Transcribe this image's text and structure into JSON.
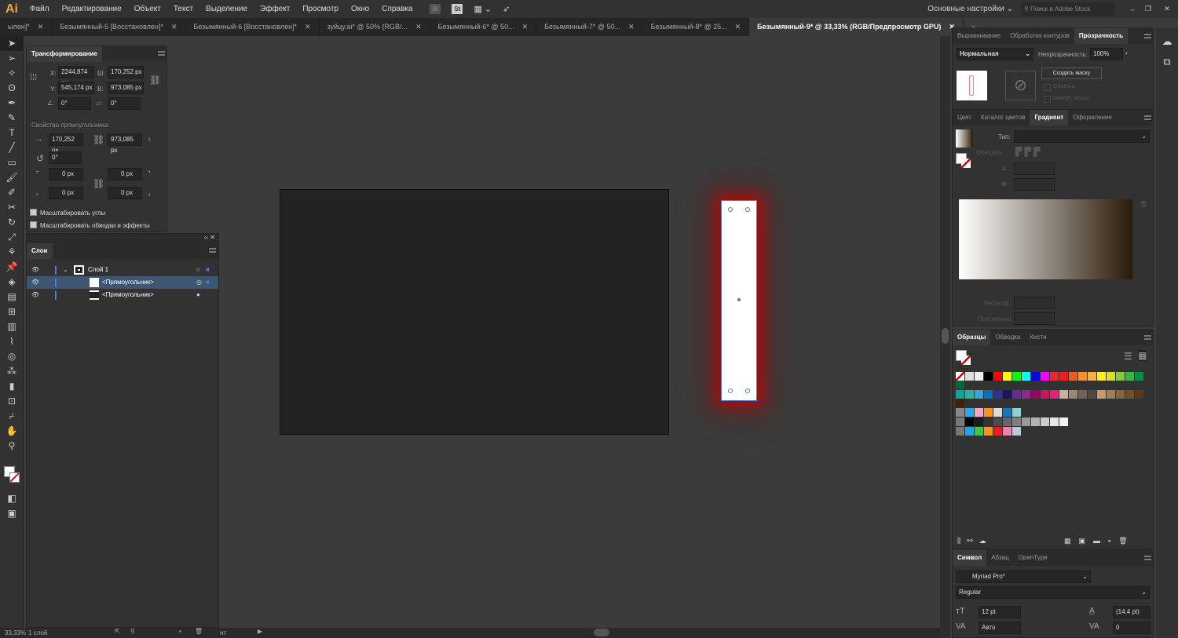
{
  "app": {
    "logo": "Ai"
  },
  "menu": [
    "Файл",
    "Редактирование",
    "Объект",
    "Текст",
    "Выделение",
    "Эффект",
    "Просмотр",
    "Окно",
    "Справка"
  ],
  "menubar_right": {
    "workspace": "Основные настройки",
    "stock_placeholder": "Поиск в Adobe Stock",
    "br": "Br",
    "st": "St"
  },
  "doc_tabs": [
    {
      "label": "ылен]*",
      "active": false
    },
    {
      "label": "Безымянный-5 [Восстановлен]*",
      "active": false
    },
    {
      "label": "Безымянный-6 [Восстановлен]*",
      "active": false
    },
    {
      "label": "зуйцу.ai* @ 50% (RGB/...",
      "active": false
    },
    {
      "label": "Безымянный-6* @ 50...",
      "active": false
    },
    {
      "label": "Безымянный-7* @ 50...",
      "active": false
    },
    {
      "label": "Безымянный-8* @ 25...",
      "active": false
    },
    {
      "label": "Безымянный-9* @ 33,33% (RGB/Предпросмотр GPU)",
      "active": true
    }
  ],
  "transform": {
    "title": "Трансформирование",
    "x_label": "X:",
    "x": "2244,874 px",
    "w_label": "Ш:",
    "w": "170,252 px",
    "y_label": "Y:",
    "y": "545,174 px",
    "h_label": "В:",
    "h": "973,085 px",
    "angle": "0°",
    "shear": "0°",
    "rect_props": "Свойства прямоугольника:",
    "rect_w": "170,252 px",
    "rect_h": "973,085 px",
    "rect_angle": "0°",
    "corner_tl": "0 px",
    "corner_tr": "0 px",
    "corner_bl": "0 px",
    "corner_br": "0 px",
    "scale_corners": "Масштабировать углы",
    "scale_strokes": "Масштабировать обводки и эффекты"
  },
  "layers": {
    "title": "Слои",
    "items": [
      {
        "name": "Слой 1",
        "indent": 0,
        "selected": false
      },
      {
        "name": "<Прямоугольник>",
        "indent": 1,
        "selected": true
      },
      {
        "name": "<Прямоугольник>",
        "indent": 1,
        "selected": false
      }
    ]
  },
  "status": {
    "zoom": "33,33%",
    "layers_count": "1 слой",
    "tool": "нт"
  },
  "transparency": {
    "tabs": [
      "Выравнивание",
      "Обработка контуров",
      "Прозрачность"
    ],
    "blend": "Нормальная",
    "opacity_label": "Непрозрачность:",
    "opacity": "100%",
    "make_mask": "Создать маску",
    "clip": "Обрезка",
    "invert": "Инверт. маска"
  },
  "gradient": {
    "tabs": [
      "Цвет",
      "Каталог цветов",
      "Градиент",
      "Оформление"
    ],
    "type_label": "Тип:",
    "stroke_label": "Обводка:",
    "opacity_label": "Непрозр.:",
    "position_label": "Положение:",
    "colors": [
      "#ffffff",
      "#2a1a08"
    ]
  },
  "swatches": {
    "tabs": [
      "Образцы",
      "Обводка",
      "Кисти"
    ],
    "rows": [
      [
        "#ffffff",
        "#dddddd",
        "#eeeeee",
        "#000000",
        "#ff0000",
        "#ffff00",
        "#00ff00",
        "#00ffff",
        "#0000ff",
        "#ff00ff",
        "#e8282b",
        "#ee1c25",
        "#f15a24",
        "#f7931e",
        "#fbb03b",
        "#fcee21",
        "#d9e021",
        "#8cc63f",
        "#39b54a",
        "#009245",
        "#006837"
      ],
      [
        "#00a99d",
        "#22b5a5",
        "#29abe2",
        "#0071bc",
        "#2e3192",
        "#1b1464",
        "#662d91",
        "#93278f",
        "#9e005d",
        "#d4145a",
        "#ed1e79",
        "#c7b299",
        "#998675",
        "#736357",
        "#534741",
        "#c69c6d",
        "#a67c52",
        "#8c6239",
        "#754c24",
        "#603813",
        "#42210b"
      ],
      [
        "#888888",
        "#29abe2",
        "#f4a6c6",
        "#f7931e",
        "#dddddd",
        "#1b75bc",
        "#8fd3d0"
      ],
      [
        "#000000",
        "#1a1a1a",
        "#333333",
        "#4d4d4d",
        "#666666",
        "#808080",
        "#999999",
        "#b3b3b3",
        "#cccccc",
        "#e6e6e6",
        "#f2f2f2"
      ],
      [
        "#1ba8e8",
        "#3ec73e",
        "#f7931e",
        "#ee1c25",
        "#f080b0",
        "#b8cbd6"
      ]
    ]
  },
  "character": {
    "tabs": [
      "Символ",
      "Абзац",
      "OpenType"
    ],
    "font": "Myriad Pro*",
    "style": "Regular",
    "size": "12 pt",
    "leading": "(14,4 pt)",
    "kerning": "Авто",
    "tracking": "0"
  }
}
